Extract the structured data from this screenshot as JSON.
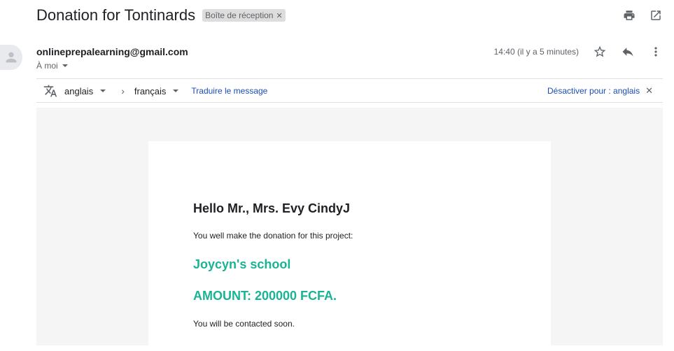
{
  "email": {
    "subject": "Donation for Tontinards",
    "label": "Boîte de réception",
    "sender": "onlineprepalearning@gmail.com",
    "recipient": "À moi",
    "time": "14:40 (il y a 5 minutes)"
  },
  "translate": {
    "from_lang": "anglais",
    "to_lang": "français",
    "translate_link": "Traduire le message",
    "disable_link": "Désactiver pour : anglais"
  },
  "body": {
    "greeting": "Hello Mr., Mrs. Evy CindyJ",
    "line1": "You well make the donation for this project:",
    "project": "Joycyn's school",
    "amount": "AMOUNT: 200000 FCFA.",
    "line2": "You will be contacted soon."
  },
  "colors": {
    "accent_green": "#1ab394",
    "link_blue": "#1a4db3"
  },
  "icons": {
    "top": [
      "print-icon",
      "open-in-new-window-icon"
    ],
    "message": [
      "star-icon",
      "reply-icon",
      "more-vert-icon"
    ]
  }
}
